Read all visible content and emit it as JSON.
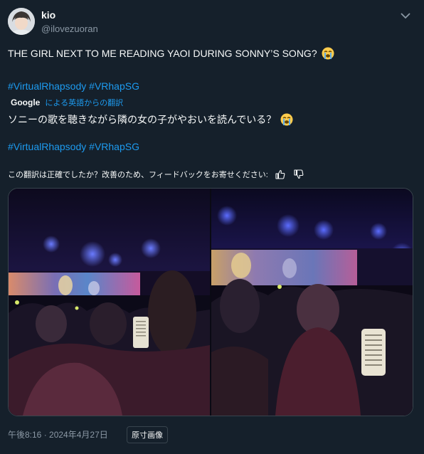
{
  "author": {
    "display_name": "kio",
    "handle": "@ilovezuoran"
  },
  "icons": {
    "more": "chevron-down-icon",
    "emoji": "loudly-crying-face-emoji",
    "thumbs_up": "thumbs-up-icon",
    "thumbs_down": "thumbs-down-icon"
  },
  "tweet": {
    "text": "THE GIRL NEXT TO ME READING YAOI DURING SONNY’S SONG?",
    "hashtags": [
      "#VirtualRhapsody",
      "#VRhapSG"
    ]
  },
  "translation": {
    "provider": "Google",
    "label": "による英語からの翻訳",
    "text": "ソニーの歌を聴きながら隣の女の子がやおいを読んでいる？",
    "hashtags": [
      "#VirtualRhapsody",
      "#VRhapSG"
    ],
    "feedback_prompt": "この翻訳は正確でしたか？改善のため、フィードバックをお寄せください:"
  },
  "footer": {
    "timestamp": "午後8:16 · 2024年4月27日",
    "original_image_button": "原寸画像"
  },
  "colors": {
    "background": "#15202b",
    "link": "#1d9bf0",
    "secondary_text": "#8b98a5",
    "border": "#38444d"
  }
}
